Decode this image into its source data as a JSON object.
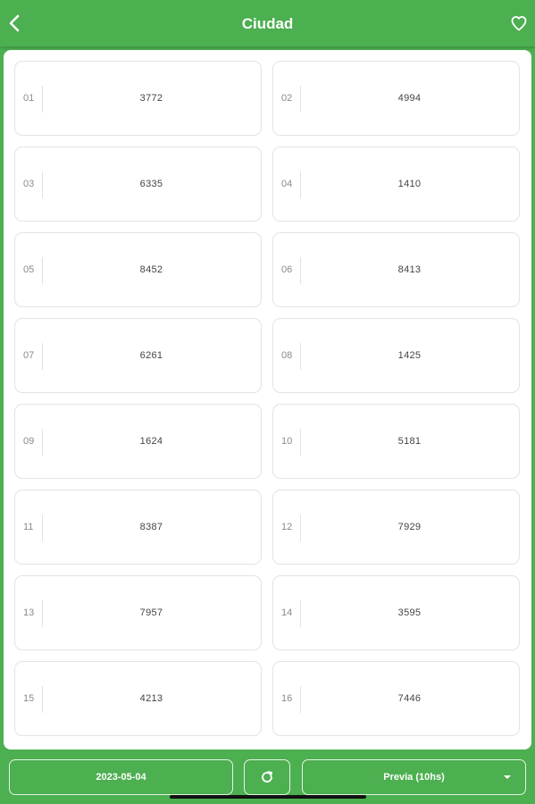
{
  "header": {
    "title": "Ciudad",
    "back_icon": "chevron-left-icon",
    "favorite_icon": "heart-icon"
  },
  "results": [
    {
      "position": "01",
      "number": "3772"
    },
    {
      "position": "02",
      "number": "4994"
    },
    {
      "position": "03",
      "number": "6335"
    },
    {
      "position": "04",
      "number": "1410"
    },
    {
      "position": "05",
      "number": "8452"
    },
    {
      "position": "06",
      "number": "8413"
    },
    {
      "position": "07",
      "number": "6261"
    },
    {
      "position": "08",
      "number": "1425"
    },
    {
      "position": "09",
      "number": "1624"
    },
    {
      "position": "10",
      "number": "5181"
    },
    {
      "position": "11",
      "number": "8387"
    },
    {
      "position": "12",
      "number": "7929"
    },
    {
      "position": "13",
      "number": "7957"
    },
    {
      "position": "14",
      "number": "3595"
    },
    {
      "position": "15",
      "number": "4213"
    },
    {
      "position": "16",
      "number": "7446"
    }
  ],
  "footer": {
    "date": "2023-05-04",
    "refresh_icon": "refresh-icon",
    "session": "Previa (10hs)",
    "session_icon": "caret-down-icon"
  },
  "colors": {
    "primary": "#4caf50",
    "card_border": "#e3e3e3",
    "text": "#444444",
    "muted_text": "#8a8a8a"
  }
}
